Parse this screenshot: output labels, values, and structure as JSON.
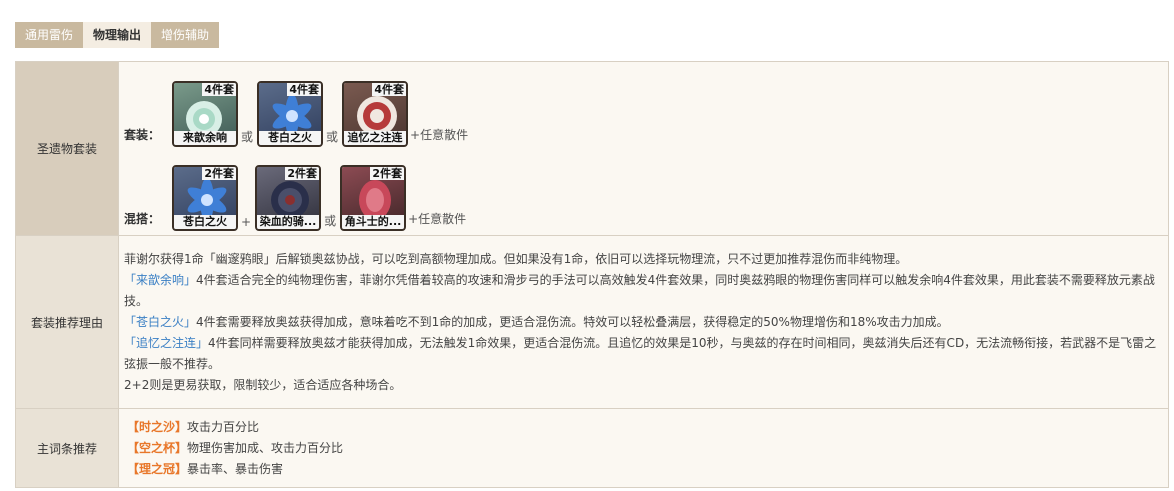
{
  "tabs": [
    {
      "label": "通用雷伤"
    },
    {
      "label": "物理输出"
    },
    {
      "label": "增伤辅助"
    }
  ],
  "artifact_sets": {
    "row_label": "圣遗物套装",
    "full_set": {
      "label": "套装：",
      "items": [
        {
          "badge": "4件套",
          "name": "来歆余响",
          "icon": "white-flower-icon"
        },
        {
          "badge": "4件套",
          "name": "苍白之火",
          "icon": "blue-flower-icon"
        },
        {
          "badge": "4件套",
          "name": "追忆之注连",
          "icon": "red-flower-icon"
        }
      ],
      "conjunction": "或",
      "tail": "+任意散件"
    },
    "mixed_set": {
      "label": "混搭：",
      "items": [
        {
          "badge": "2件套",
          "name": "苍白之火",
          "icon": "blue-flower-icon"
        },
        {
          "badge": "2件套",
          "name": "染血的骑...",
          "icon": "dark-flower-icon"
        },
        {
          "badge": "2件套",
          "name": "角斗士的...",
          "icon": "pink-flower-icon"
        }
      ],
      "plus": "+",
      "conjunction": "或",
      "tail": "+任意散件"
    }
  },
  "reason": {
    "row_label": "套装推荐理由",
    "p1": "菲谢尔获得1命「幽邃鸦眼」后解锁奥兹协战，可以吃到高额物理加成。但如果没有1命，依旧可以选择玩物理流，只不过更加推荐混伤而非纯物理。",
    "p2_tag": "「来歆余响」",
    "p2_text": "4件套适合完全的纯物理伤害，菲谢尔凭借着较高的攻速和滑步弓的手法可以高效触发4件套效果，同时奥兹鸦眼的物理伤害同样可以触发余响4件套效果，用此套装不需要释放元素战技。",
    "p3_tag": "「苍白之火」",
    "p3_text": "4件套需要释放奥兹获得加成，意味着吃不到1命的加成，更适合混伤流。特效可以轻松叠满层，获得稳定的50%物理增伤和18%攻击力加成。",
    "p4_tag": "「追忆之注连」",
    "p4_text": "4件套同样需要释放奥兹才能获得加成，无法触发1命效果，更适合混伤流。且追忆的效果是10秒，与奥兹的存在时间相同，奥兹消失后还有CD，无法流畅衔接，若武器不是飞雷之弦振一般不推荐。",
    "p5": "2+2则是更易获取，限制较少，适合适应各种场合。"
  },
  "main_stats": {
    "row_label": "主词条推荐",
    "items": [
      {
        "tag": "【时之沙】",
        "text": "攻击力百分比"
      },
      {
        "tag": "【空之杯】",
        "text": "物理伤害加成、攻击力百分比"
      },
      {
        "tag": "【理之冠】",
        "text": "暴击率、暴击伤害"
      }
    ]
  }
}
